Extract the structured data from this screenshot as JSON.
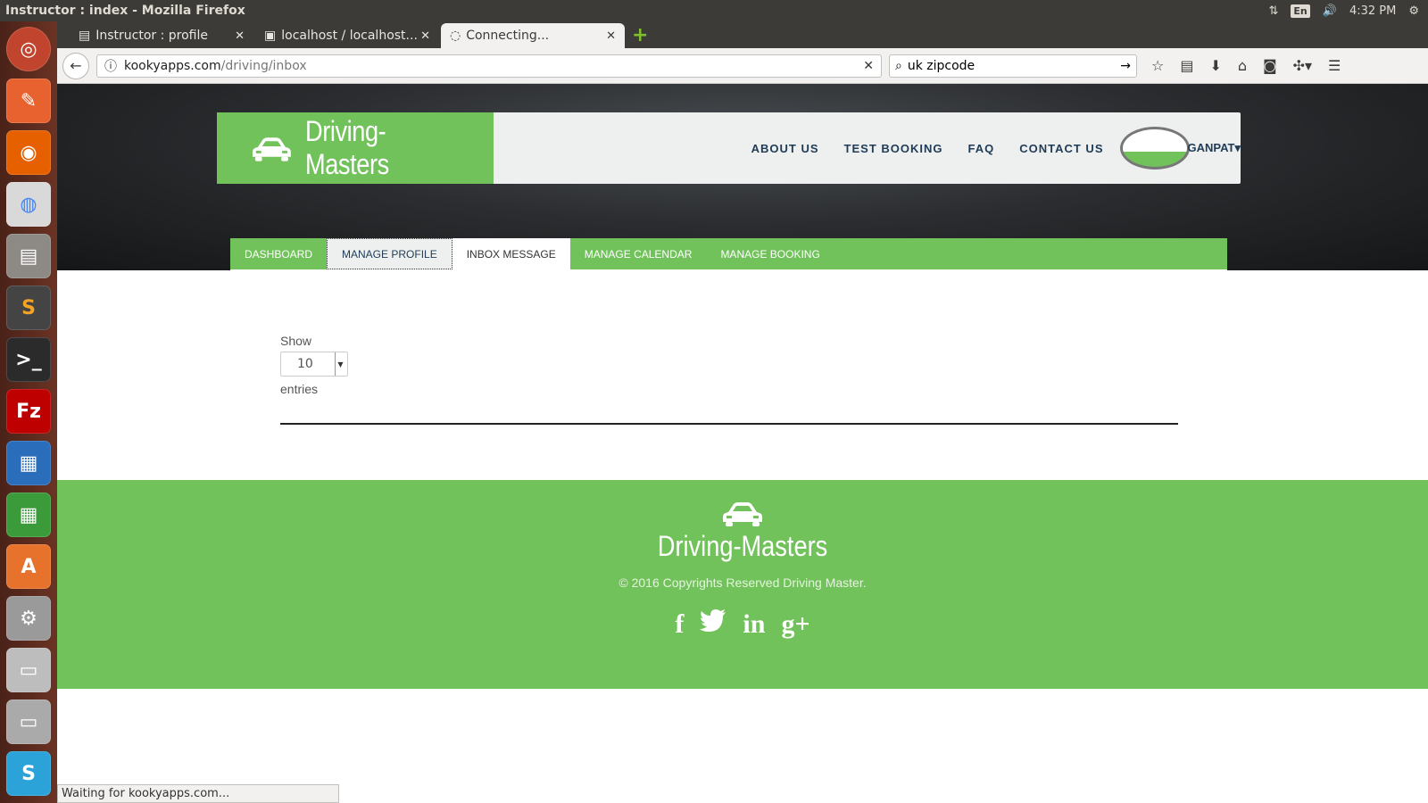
{
  "window": {
    "title": "Instructor : index - Mozilla Firefox"
  },
  "tray": {
    "lang": "En",
    "time": "4:32 PM"
  },
  "tabs": [
    {
      "label": "Instructor : profile"
    },
    {
      "label": "localhost / localhost..."
    },
    {
      "label": "Connecting..."
    }
  ],
  "urlbar": {
    "host": "kookyapps.com",
    "path": "/driving/inbox"
  },
  "search": {
    "value": "uk zipcode"
  },
  "site": {
    "brand": "Driving-Masters",
    "menu": [
      "ABOUT US",
      "TEST BOOKING",
      "FAQ",
      "CONTACT US"
    ],
    "user": "GANPAT"
  },
  "dashboard_tabs": [
    "DASHBOARD",
    "MANAGE PROFILE",
    "INBOX MESSAGE",
    "MANAGE CALENDAR",
    "MANAGE BOOKING"
  ],
  "table_controls": {
    "show_label": "Show",
    "page_size": "10",
    "entries_label": "entries"
  },
  "footer": {
    "brand": "Driving-Masters",
    "copyright": "© 2016 Copyrights Reserved Driving Master.",
    "social": [
      "f",
      "t",
      "in",
      "g+"
    ]
  },
  "status": {
    "text": "Waiting for kookyapps.com..."
  },
  "colors": {
    "brand_green": "#72c25c",
    "nav_text": "#1f3b57"
  }
}
